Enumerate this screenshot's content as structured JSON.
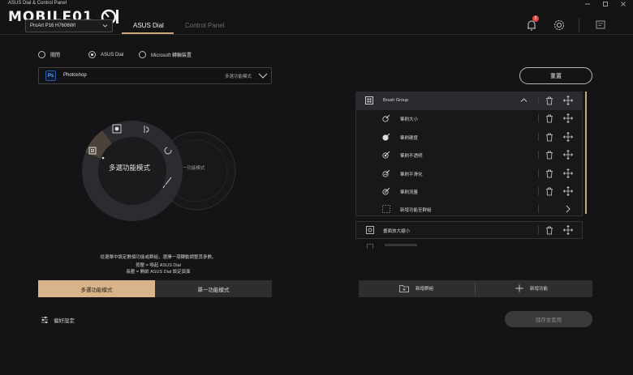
{
  "window": {
    "title": "ASUS Dial & Control Panel",
    "controls": [
      "minimize-icon",
      "maximize-icon",
      "close-icon"
    ]
  },
  "header": {
    "logo_text": "MOBILE01",
    "device": "ProArt P16 H7606WI",
    "tabs": [
      {
        "label": "ASUS Dial",
        "active": true
      },
      {
        "label": "Control Panel",
        "active": false
      }
    ],
    "notification_count": "2",
    "accent_color": "#c9a97a"
  },
  "options": {
    "radios": [
      {
        "label": "關閉",
        "selected": false
      },
      {
        "label": "ASUS Dial",
        "selected": true
      },
      {
        "label": "Microsoft 轉輪裝置",
        "selected": false
      }
    ]
  },
  "app_select": {
    "icon_text": "Ps",
    "app": "Photoshop",
    "mode": "多選功能模式"
  },
  "dial": {
    "center_label": "多選功能模式",
    "ghost_label": "一功能模式"
  },
  "instructions": {
    "line1": "從選單中設定數個功能或群組，選擇一項轉動調整其參數。",
    "line2": "按壓 = 喚起 ASUS Dial",
    "line3": "長壓 = 開啟 ASUS Dial 設定頁面"
  },
  "mode_buttons": {
    "multi": "多選功能模式",
    "single": "單一功能模式"
  },
  "preferences": {
    "label": "偏好設定"
  },
  "right_panel": {
    "reset_label": "重置",
    "group": {
      "name": "Brush Group",
      "items": [
        {
          "label": "筆刷大小",
          "icon": "brush-size-icon"
        },
        {
          "label": "筆刷硬度",
          "icon": "brush-hardness-icon"
        },
        {
          "label": "筆刷不透明",
          "icon": "brush-opacity-icon"
        },
        {
          "label": "筆刷平滑化",
          "icon": "brush-smoothing-icon"
        },
        {
          "label": "筆刷流量",
          "icon": "brush-flow-icon"
        }
      ],
      "add_to_group": "新增功能至群組"
    },
    "second_item": "畫面放大縮小",
    "add_group": "新增群組",
    "add_function": "新增功能",
    "save_apply": "儲存並套用"
  }
}
